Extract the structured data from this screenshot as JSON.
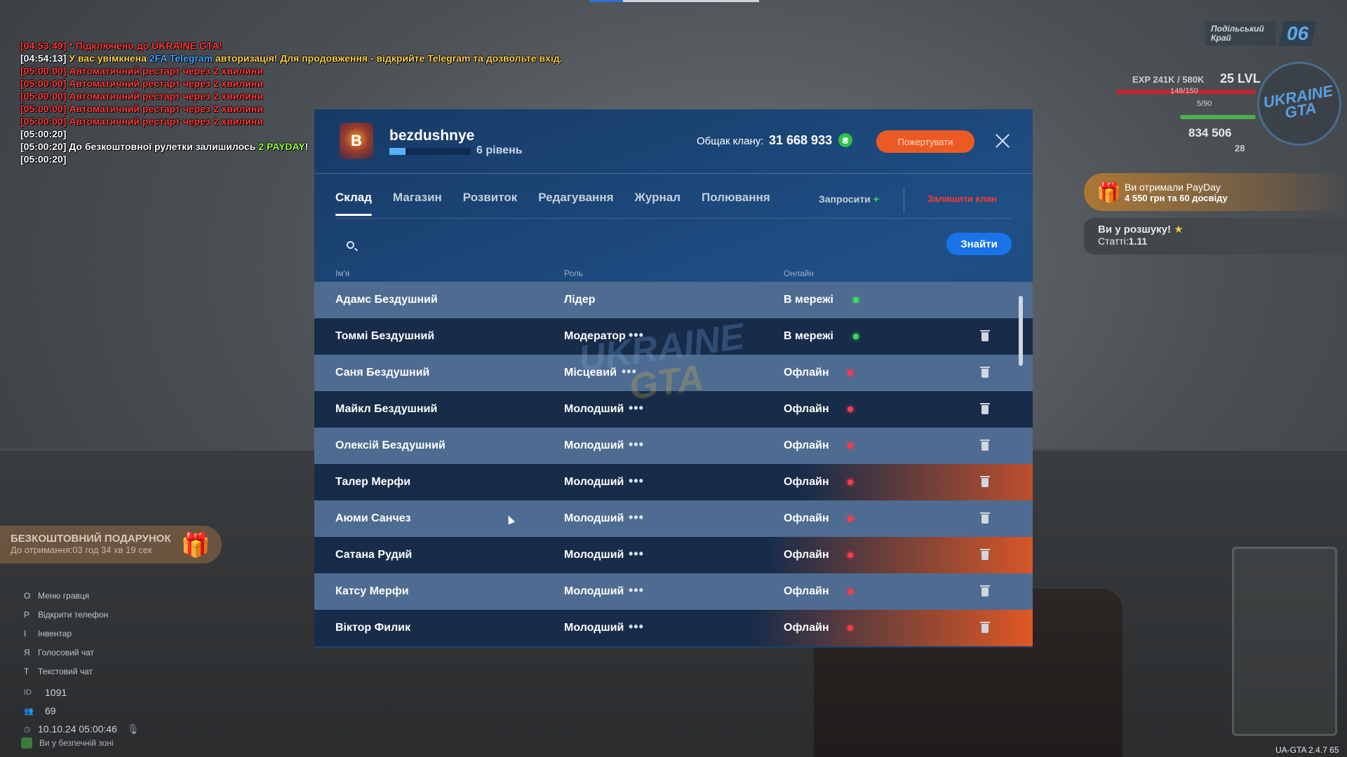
{
  "chat": [
    {
      "parts": [
        {
          "t": "[04:53:49] * Підключено до UKRAINE GTA!",
          "c": "red"
        }
      ]
    },
    {
      "parts": [
        {
          "t": "[04:54:13] ",
          "c": "white"
        },
        {
          "t": "У вас увімкнена ",
          "c": "yellow"
        },
        {
          "t": "2FA Telegram",
          "c": "blue"
        },
        {
          "t": " авторизація! Для продовження - відкрийте Telegram та дозвольте вхід.",
          "c": "yellow"
        }
      ]
    },
    {
      "parts": [
        {
          "t": "[05:00:00] Автоматичний рестарт через 2 хвилини",
          "c": "red"
        }
      ]
    },
    {
      "parts": [
        {
          "t": "[05:00:00] Автоматичний рестарт через 2 хвилини",
          "c": "red"
        }
      ]
    },
    {
      "parts": [
        {
          "t": "[05:00:00] Автоматичний рестарт через 2 хвилини",
          "c": "red"
        }
      ]
    },
    {
      "parts": [
        {
          "t": "[05:00:00] Автоматичний рестарт через 2 хвилини",
          "c": "red"
        }
      ]
    },
    {
      "parts": [
        {
          "t": "[05:00:00] Автоматичний рестарт через 2 хвилини",
          "c": "red"
        }
      ]
    },
    {
      "parts": [
        {
          "t": "[05:00:20]",
          "c": "white"
        }
      ]
    },
    {
      "parts": [
        {
          "t": "[05:00:20] До безкоштовної рулетки залишилось ",
          "c": "white"
        },
        {
          "t": "2 PAYDAY",
          "c": "green"
        },
        {
          "t": "!",
          "c": "white"
        }
      ]
    },
    {
      "parts": [
        {
          "t": "[05:00:20]",
          "c": "white"
        }
      ]
    }
  ],
  "hud": {
    "region_name": "Подільський Край",
    "region_code": "06",
    "exp": "EXP 241K / 580K",
    "level": "25 LVL",
    "hp": "148/150",
    "food": "5/90",
    "money": "834 506",
    "coins": "28",
    "logo_line1": "UKRAINE",
    "logo_line2": "GTA",
    "payday_title": "Ви отримали PayDay",
    "payday_sub": "4 550 грн та 60 досвіду",
    "wanted_title": "Ви у розшуку!",
    "wanted_sub_label": "Статті:",
    "wanted_sub_value": "1.11",
    "version": "UA-GTA 2.4.7   65"
  },
  "left_hud": {
    "gift_title": "БЕЗКОШТОВНИЙ ПОДАРУНОК",
    "gift_sub": "До отримання:03 год 34 хв 19 сек",
    "keys": [
      {
        "key": "O",
        "label": "Меню гравця"
      },
      {
        "key": "P",
        "label": "Відкрити телефон"
      },
      {
        "key": "I",
        "label": "Інвентар"
      },
      {
        "key": "Я",
        "label": "Голосовий чат"
      },
      {
        "key": "T",
        "label": "Текстовий чат"
      }
    ],
    "id_label": "ID",
    "id_value": "1091",
    "online_value": "69",
    "datetime": "10.10.24 05:00:46",
    "safe_zone": "Ви у безпечній зоні"
  },
  "panel": {
    "logo_text": "B",
    "clan_name": "bezdushnye",
    "level_text": "6 рівень",
    "level_progress": 0.2,
    "money_label": "Общак клану:",
    "money_value": "31 668 933",
    "money_icon": "₴",
    "donate_label": "Пожертувати",
    "tabs": [
      "Склад",
      "Магазин",
      "Розвиток",
      "Редагування",
      "Журнал",
      "Полювання"
    ],
    "active_tab": 0,
    "invite_label": "Запросити",
    "invite_plus": "+",
    "leave_label": "Залишити клан",
    "search_placeholder": "",
    "find_label": "Знайти",
    "columns": {
      "name": "Ім'я",
      "role": "Роль",
      "online": "Онлайн"
    },
    "watermark_1": "UKRAINE",
    "watermark_2": "GTA",
    "members": [
      {
        "name": "Адамс Бездушний",
        "role": "Лідер",
        "status": "В мережі",
        "online": true,
        "menu": false,
        "trash": false,
        "glow": 0
      },
      {
        "name": "Томмі Бездушний",
        "role": "Модератор",
        "status": "В мережі",
        "online": true,
        "menu": true,
        "trash": true,
        "glow": 0
      },
      {
        "name": "Саня Бездушний",
        "role": "Місцевий",
        "status": "Офлайн",
        "online": false,
        "menu": true,
        "trash": true,
        "glow": 0
      },
      {
        "name": "Майкл Бездушний",
        "role": "Молодший",
        "status": "Офлайн",
        "online": false,
        "menu": true,
        "trash": true,
        "glow": 0
      },
      {
        "name": "Олексій Бездушний",
        "role": "Молодший",
        "status": "Офлайн",
        "online": false,
        "menu": true,
        "trash": true,
        "glow": 0
      },
      {
        "name": "Талер Мерфи",
        "role": "Молодший",
        "status": "Офлайн",
        "online": false,
        "menu": true,
        "trash": true,
        "glow": 0.5
      },
      {
        "name": "Аюми Санчез",
        "role": "Молодший",
        "status": "Офлайн",
        "online": false,
        "menu": true,
        "trash": true,
        "glow": 0
      },
      {
        "name": "Сатана Рудий",
        "role": "Молодший",
        "status": "Офлайн",
        "online": false,
        "menu": true,
        "trash": true,
        "glow": 0.85
      },
      {
        "name": "Катсу Мерфи",
        "role": "Молодший",
        "status": "Офлайн",
        "online": false,
        "menu": true,
        "trash": true,
        "glow": 0
      },
      {
        "name": "Віктор Филик",
        "role": "Молодший",
        "status": "Офлайн",
        "online": false,
        "menu": true,
        "trash": true,
        "glow": 1
      }
    ],
    "menu_glyph": "•••"
  },
  "colors": {
    "panel_bg": "#1f4f86",
    "row_light": "#4e6c91",
    "row_dark": "#162c49",
    "accent_orange": "#ec5a24",
    "accent_blue": "#1a73e8",
    "online_green": "#3fdc5a",
    "offline_red": "#ff3b4a"
  },
  "icons": [
    "search-icon",
    "close-icon",
    "trash-icon",
    "more-dots-icon",
    "gift-icon",
    "money-icon",
    "star-icon",
    "mic-icon",
    "clock-icon",
    "users-icon"
  ]
}
